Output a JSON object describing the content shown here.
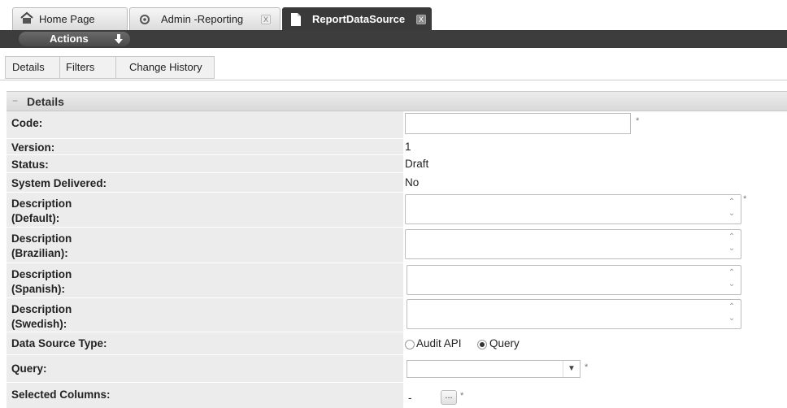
{
  "tabs": [
    {
      "label": "Home Page"
    },
    {
      "label": "Admin -Reporting",
      "close": "X"
    },
    {
      "label": "ReportDataSource",
      "close": "X"
    }
  ],
  "actions": {
    "label": "Actions"
  },
  "subtabs": [
    "Details",
    "Filters",
    "Change History"
  ],
  "section": {
    "title": "Details"
  },
  "form": {
    "code_label": "Code:",
    "version_label": "Version:",
    "version_value": "1",
    "status_label": "Status:",
    "status_value": "Draft",
    "system_delivered_label": "System Delivered:",
    "system_delivered_value": "No",
    "desc_default_label": [
      "Description",
      "(Default):"
    ],
    "desc_brazilian_label": [
      "Description",
      "(Brazilian):"
    ],
    "desc_spanish_label": [
      "Description",
      "(Spanish):"
    ],
    "desc_swedish_label": [
      "Description",
      "(Swedish):"
    ],
    "data_source_type_label": "Data Source Type:",
    "data_source_options": [
      "Audit API",
      "Query"
    ],
    "data_source_selected": "Query",
    "query_label": "Query:",
    "selected_columns_label": "Selected Columns:",
    "selected_columns_value": "-",
    "ellipsis": "...",
    "required_marker": "*"
  },
  "icons": {
    "home": "house-icon",
    "gear": "gear-icon",
    "document": "document-icon",
    "actions_arrow": "down-arrow-icon",
    "collapse": "minus-icon",
    "dropdown": "chevron-down-icon"
  }
}
